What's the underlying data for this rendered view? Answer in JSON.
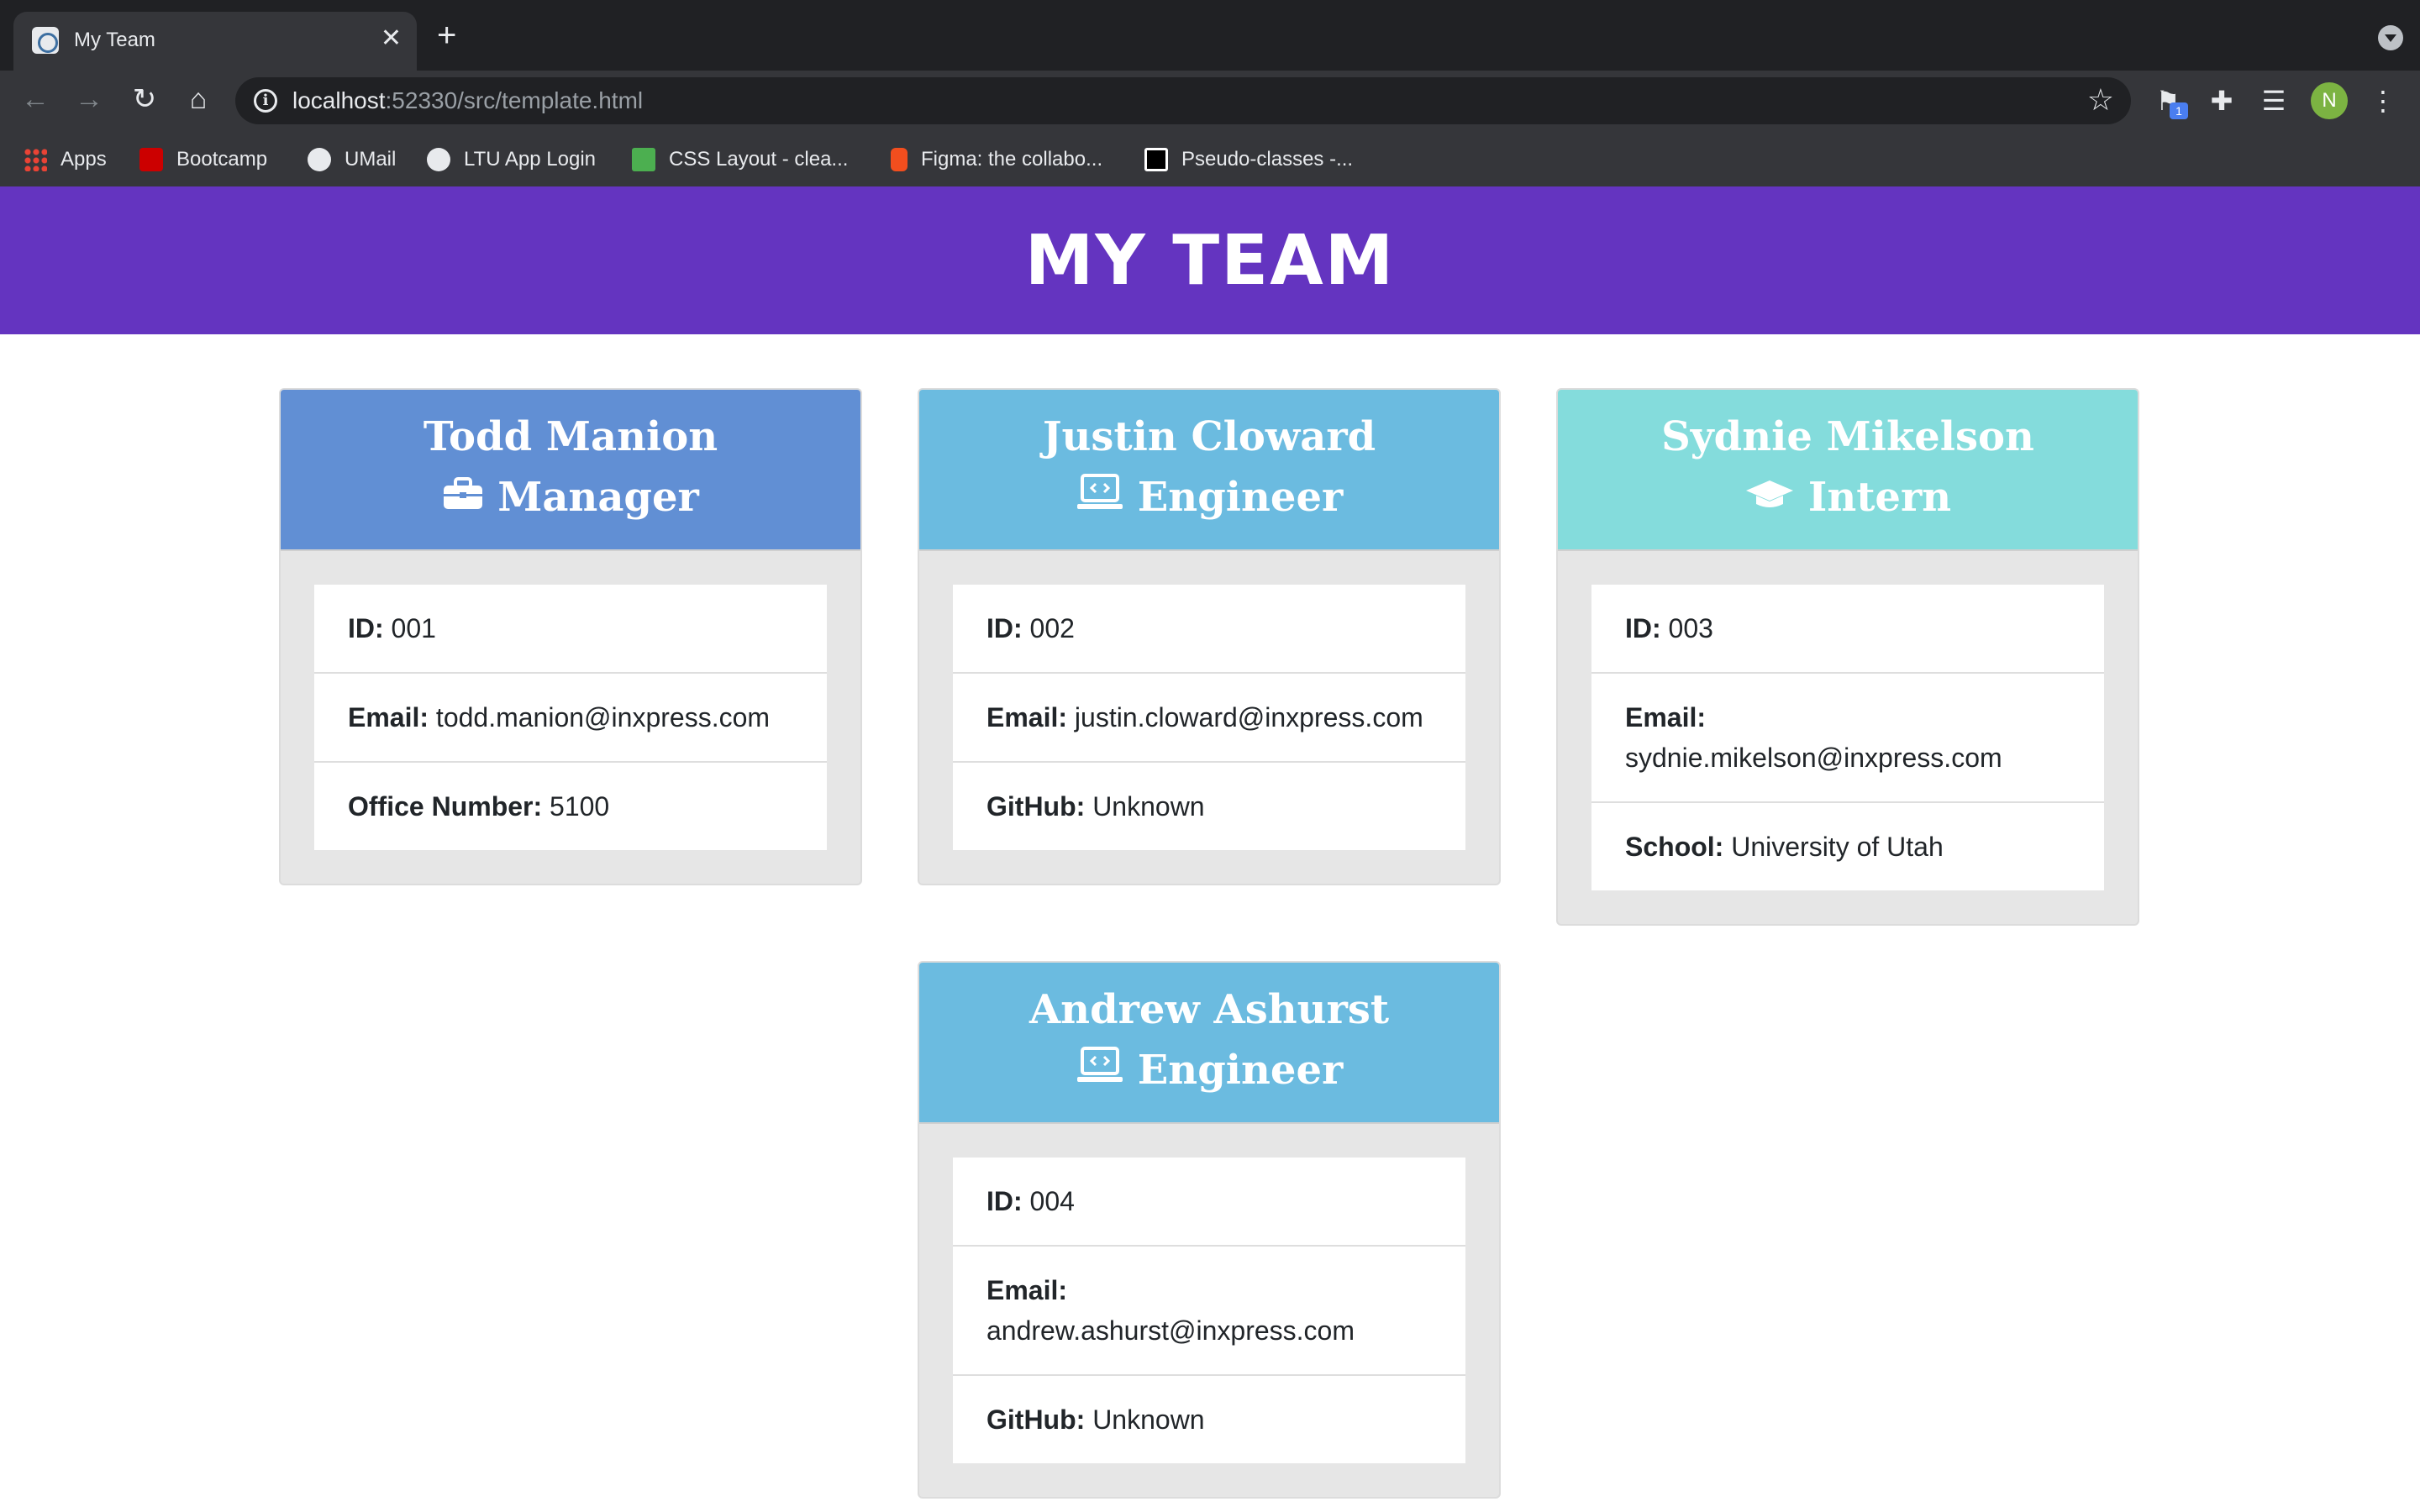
{
  "browser": {
    "tab_title": "My Team",
    "tab_close": "✕",
    "new_tab": "+",
    "url_host": "localhost",
    "url_rest": ":52330/src/template.html",
    "profile_initial": "N",
    "extension_badge": "1",
    "bookmarks": [
      {
        "label": "Apps",
        "icon": "apps-grid-icon",
        "color": "#ea4335"
      },
      {
        "label": "Bootcamp",
        "icon": "utah-u-icon",
        "color": "#cc0000"
      },
      {
        "label": "UMail",
        "icon": "globe-icon",
        "color": "#e8eaed"
      },
      {
        "label": "LTU App Login",
        "icon": "globe-icon",
        "color": "#e8eaed"
      },
      {
        "label": "CSS Layout - clea...",
        "icon": "w-icon",
        "color": "#4caf50"
      },
      {
        "label": "Figma: the collabo...",
        "icon": "figma-icon",
        "color": "#f24e1e"
      },
      {
        "label": "Pseudo-classes -...",
        "icon": "mdn-icon",
        "color": "#000000"
      }
    ]
  },
  "page": {
    "title": "MY TEAM"
  },
  "labels": {
    "id": "ID:",
    "email": "Email:",
    "office": "Office Number:",
    "github": "GitHub:",
    "school": "School:"
  },
  "team": [
    {
      "name": "Todd Manion",
      "role": "Manager",
      "icon": "briefcase-icon",
      "color": "#618fd4",
      "id": "001",
      "email": "todd.manion@inxpress.com",
      "extra_label": "Office Number:",
      "extra": "5100"
    },
    {
      "name": "Justin Cloward",
      "role": "Engineer",
      "icon": "laptop-code-icon",
      "color": "#6bbbe0",
      "id": "002",
      "email": "justin.cloward@inxpress.com",
      "extra_label": "GitHub:",
      "extra": "Unknown"
    },
    {
      "name": "Sydnie Mikelson",
      "role": "Intern",
      "icon": "graduation-cap-icon",
      "color": "#84dcdc",
      "id": "003",
      "email": "sydnie.mikelson@inxpress.com",
      "extra_label": "School:",
      "extra": "University of Utah"
    },
    {
      "name": "Andrew Ashurst",
      "role": "Engineer",
      "icon": "laptop-code-icon",
      "color": "#6bbbe0",
      "id": "004",
      "email": "andrew.ashurst@inxpress.com",
      "extra_label": "GitHub:",
      "extra": "Unknown"
    }
  ]
}
